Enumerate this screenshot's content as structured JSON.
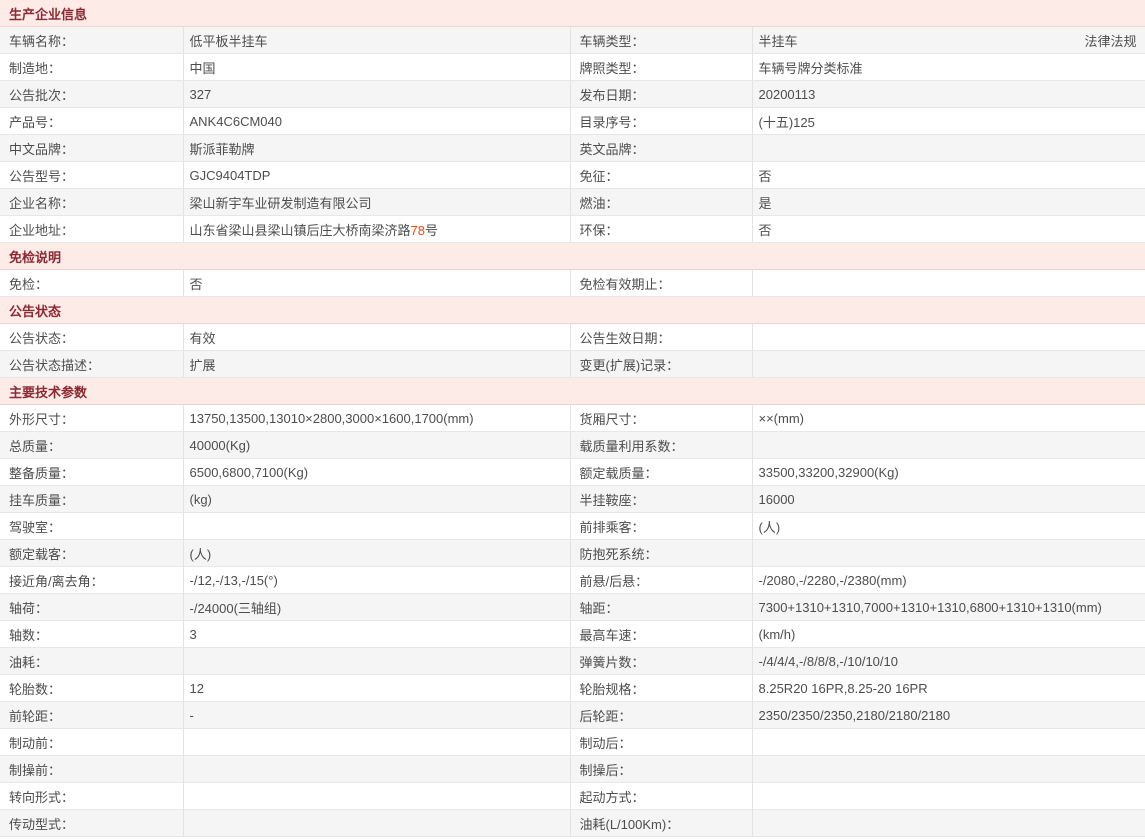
{
  "colors": {
    "section_header_bg": "#fdebe7",
    "section_header_text": "#8b2a33",
    "row_alt_bg": "#f5f5f5",
    "border": "#e3e3e3",
    "text": "#4d4d4d",
    "highlight": "#ff4400"
  },
  "sections": [
    {
      "title": "生产企业信息",
      "first_row_shaded": true,
      "rows": [
        {
          "l1": "车辆名称：",
          "v1": "低平板半挂车",
          "l2": "车辆类型：",
          "v2": "半挂车",
          "v2_link": "法律法规"
        },
        {
          "l1": "制造地：",
          "v1": "中国",
          "l2": "牌照类型：",
          "v2": "车辆号牌分类标准"
        },
        {
          "l1": "公告批次：",
          "v1": "327",
          "l2": "发布日期：",
          "v2": "20200113"
        },
        {
          "l1": "产品号：",
          "v1": "ANK4C6CM040",
          "l2": "目录序号：",
          "v2": "(十五)125"
        },
        {
          "l1": "中文品牌：",
          "v1": "斯派菲勒牌",
          "l2": "英文品牌：",
          "v2": ""
        },
        {
          "l1": "公告型号：",
          "v1": "GJC9404TDP",
          "l2": "免征：",
          "v2": "否"
        },
        {
          "l1": "企业名称：",
          "v1": "梁山新宇车业研发制造有限公司",
          "l2": "燃油：",
          "v2": "是"
        },
        {
          "l1": "企业地址：",
          "v1_parts": [
            {
              "t": "山东省梁山县梁山镇后庄大桥南梁济路"
            },
            {
              "t": "78",
              "hl": true
            },
            {
              "t": "号"
            }
          ],
          "l2": "环保：",
          "v2": "否"
        }
      ]
    },
    {
      "title": "免检说明",
      "first_row_shaded": false,
      "rows": [
        {
          "l1": "免检：",
          "v1": "否",
          "l2": "免检有效期止：",
          "v2": ""
        }
      ]
    },
    {
      "title": "公告状态",
      "first_row_shaded": false,
      "rows": [
        {
          "l1": "公告状态：",
          "v1": "有效",
          "l2": "公告生效日期：",
          "v2": ""
        },
        {
          "l1": "公告状态描述：",
          "v1": "扩展",
          "l2": "变更(扩展)记录：",
          "v2": ""
        }
      ]
    },
    {
      "title": "主要技术参数",
      "first_row_shaded": false,
      "rows": [
        {
          "l1": "外形尺寸：",
          "v1": "13750,13500,13010×2800,3000×1600,1700(mm)",
          "l2": "货厢尺寸：",
          "v2": "××(mm)"
        },
        {
          "l1": "总质量：",
          "v1": "40000(Kg)",
          "l2": "载质量利用系数：",
          "v2": ""
        },
        {
          "l1": "整备质量：",
          "v1": "6500,6800,7100(Kg)",
          "l2": "额定载质量：",
          "v2": "33500,33200,32900(Kg)"
        },
        {
          "l1": "挂车质量：",
          "v1": "(kg)",
          "l2": "半挂鞍座：",
          "v2": "16000"
        },
        {
          "l1": "驾驶室：",
          "v1": "",
          "l2": "前排乘客：",
          "v2": "(人)"
        },
        {
          "l1": "额定载客：",
          "v1": "(人)",
          "l2": "防抱死系统：",
          "v2": ""
        },
        {
          "l1": "接近角/离去角：",
          "v1": "-/12,-/13,-/15(°)",
          "l2": "前悬/后悬：",
          "v2": "-/2080,-/2280,-/2380(mm)"
        },
        {
          "l1": "轴荷：",
          "v1": "-/24000(三轴组)",
          "l2": "轴距：",
          "v2": "7300+1310+1310,7000+1310+1310,6800+1310+1310(mm)"
        },
        {
          "l1": "轴数：",
          "v1": "3",
          "l2": "最高车速：",
          "v2": "(km/h)"
        },
        {
          "l1": "油耗：",
          "v1": "",
          "l2": "弹簧片数：",
          "v2": "-/4/4/4,-/8/8/8,-/10/10/10"
        },
        {
          "l1": "轮胎数：",
          "v1": "12",
          "l2": "轮胎规格：",
          "v2": "8.25R20 16PR,8.25-20 16PR"
        },
        {
          "l1": "前轮距：",
          "v1": "-",
          "l2": "后轮距：",
          "v2": "2350/2350/2350,2180/2180/2180"
        },
        {
          "l1": "制动前：",
          "v1": "",
          "l2": "制动后：",
          "v2": ""
        },
        {
          "l1": "制操前：",
          "v1": "",
          "l2": "制操后：",
          "v2": ""
        },
        {
          "l1": "转向形式：",
          "v1": "",
          "l2": "起动方式：",
          "v2": ""
        },
        {
          "l1": "传动型式：",
          "v1": "",
          "l2": "油耗(L/100Km)：",
          "v2": ""
        }
      ]
    }
  ]
}
